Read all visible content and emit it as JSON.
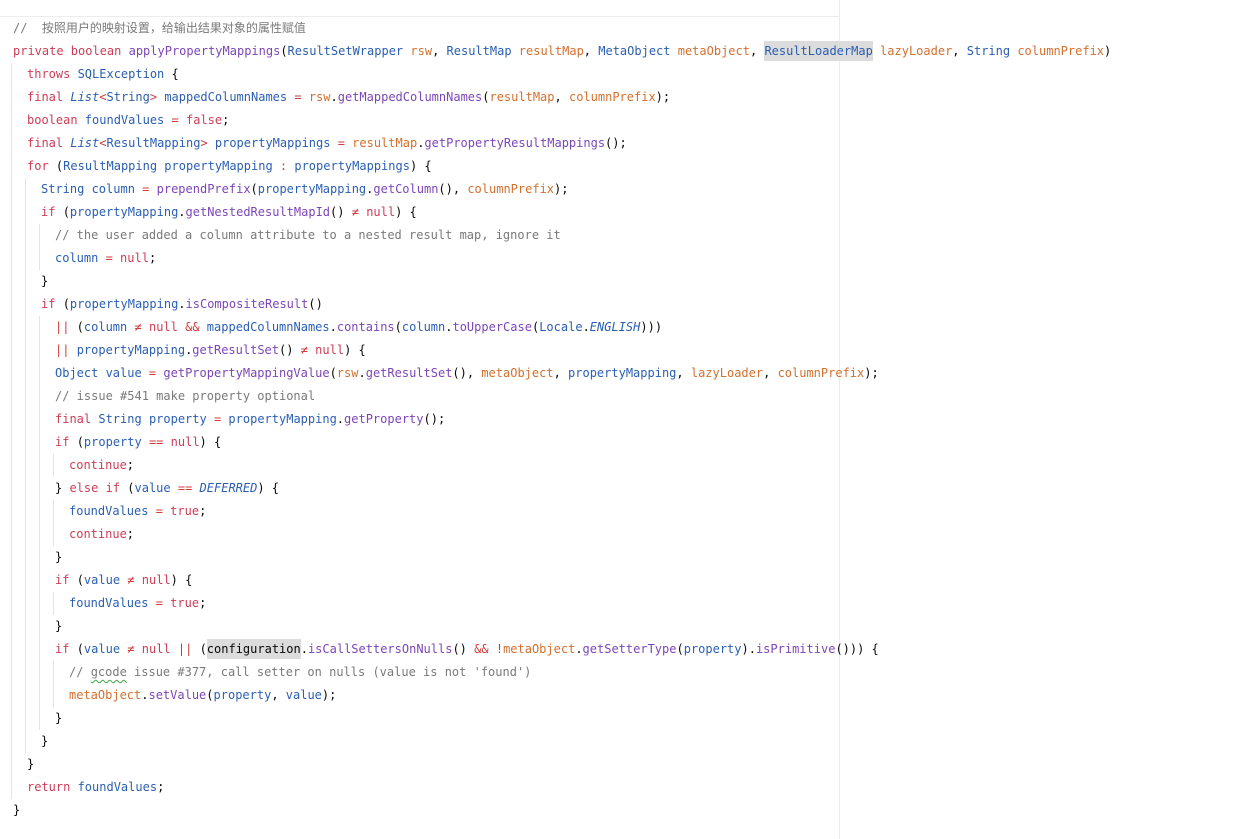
{
  "editor": {
    "lines": [
      {
        "indent": 0,
        "tokens": [
          {
            "t": "//  按照用户的映射设置，给输出结果对象的属性赋值",
            "c": "co"
          }
        ]
      },
      {
        "indent": 0,
        "tokens": [
          {
            "t": "private ",
            "c": "kw"
          },
          {
            "t": "boolean ",
            "c": "kw"
          },
          {
            "t": "applyPropertyMappings",
            "c": "me"
          },
          {
            "t": "(",
            "c": "pu"
          },
          {
            "t": "ResultSetWrapper ",
            "c": "ty"
          },
          {
            "t": "rsw",
            "c": "pa"
          },
          {
            "t": ", ",
            "c": "pu"
          },
          {
            "t": "ResultMap ",
            "c": "ty"
          },
          {
            "t": "resultMap",
            "c": "pa"
          },
          {
            "t": ", ",
            "c": "pu"
          },
          {
            "t": "MetaObject ",
            "c": "ty"
          },
          {
            "t": "metaObject",
            "c": "pa"
          },
          {
            "t": ", ",
            "c": "pu"
          },
          {
            "t": "ResultLoaderMap",
            "c": "ty hl"
          },
          {
            "t": " ",
            "c": "pu"
          },
          {
            "t": "lazyLoader",
            "c": "pa"
          },
          {
            "t": ", ",
            "c": "pu"
          },
          {
            "t": "String ",
            "c": "ty"
          },
          {
            "t": "columnPrefix",
            "c": "pa"
          },
          {
            "t": ")",
            "c": "pu"
          }
        ]
      },
      {
        "indent": 1,
        "tokens": [
          {
            "t": "throws ",
            "c": "kw"
          },
          {
            "t": "SQLException",
            "c": "ty"
          },
          {
            "t": " {",
            "c": "pu"
          }
        ]
      },
      {
        "indent": 1,
        "tokens": [
          {
            "t": "final ",
            "c": "kw"
          },
          {
            "t": "List",
            "c": "ty-it"
          },
          {
            "t": "<",
            "c": "op"
          },
          {
            "t": "String",
            "c": "ty"
          },
          {
            "t": "> ",
            "c": "op"
          },
          {
            "t": "mappedColumnNames",
            "c": "va"
          },
          {
            "t": " = ",
            "c": "op"
          },
          {
            "t": "rsw",
            "c": "pa"
          },
          {
            "t": ".",
            "c": "pu"
          },
          {
            "t": "getMappedColumnNames",
            "c": "me"
          },
          {
            "t": "(",
            "c": "pu"
          },
          {
            "t": "resultMap",
            "c": "pa"
          },
          {
            "t": ", ",
            "c": "pu"
          },
          {
            "t": "columnPrefix",
            "c": "pa"
          },
          {
            "t": ");",
            "c": "pu"
          }
        ]
      },
      {
        "indent": 1,
        "tokens": [
          {
            "t": "boolean ",
            "c": "kw"
          },
          {
            "t": "foundValues",
            "c": "va"
          },
          {
            "t": " = ",
            "c": "op"
          },
          {
            "t": "false",
            "c": "kw"
          },
          {
            "t": ";",
            "c": "pu"
          }
        ]
      },
      {
        "indent": 1,
        "tokens": [
          {
            "t": "final ",
            "c": "kw"
          },
          {
            "t": "List",
            "c": "ty-it"
          },
          {
            "t": "<",
            "c": "op"
          },
          {
            "t": "ResultMapping",
            "c": "ty"
          },
          {
            "t": "> ",
            "c": "op"
          },
          {
            "t": "propertyMappings",
            "c": "va"
          },
          {
            "t": " = ",
            "c": "op"
          },
          {
            "t": "resultMap",
            "c": "pa"
          },
          {
            "t": ".",
            "c": "pu"
          },
          {
            "t": "getPropertyResultMappings",
            "c": "me"
          },
          {
            "t": "();",
            "c": "pu"
          }
        ]
      },
      {
        "indent": 1,
        "tokens": [
          {
            "t": "for ",
            "c": "kw"
          },
          {
            "t": "(",
            "c": "pu"
          },
          {
            "t": "ResultMapping ",
            "c": "ty"
          },
          {
            "t": "propertyMapping",
            "c": "va"
          },
          {
            "t": " : ",
            "c": "op"
          },
          {
            "t": "propertyMappings",
            "c": "va"
          },
          {
            "t": ") {",
            "c": "pu"
          }
        ]
      },
      {
        "indent": 2,
        "tokens": [
          {
            "t": "String ",
            "c": "ty"
          },
          {
            "t": "column",
            "c": "va"
          },
          {
            "t": " = ",
            "c": "op"
          },
          {
            "t": "prependPrefix",
            "c": "me"
          },
          {
            "t": "(",
            "c": "pu"
          },
          {
            "t": "propertyMapping",
            "c": "va"
          },
          {
            "t": ".",
            "c": "pu"
          },
          {
            "t": "getColumn",
            "c": "me"
          },
          {
            "t": "(), ",
            "c": "pu"
          },
          {
            "t": "columnPrefix",
            "c": "pa"
          },
          {
            "t": ");",
            "c": "pu"
          }
        ]
      },
      {
        "indent": 2,
        "tokens": [
          {
            "t": "if ",
            "c": "kw"
          },
          {
            "t": "(",
            "c": "pu"
          },
          {
            "t": "propertyMapping",
            "c": "va"
          },
          {
            "t": ".",
            "c": "pu"
          },
          {
            "t": "getNestedResultMapId",
            "c": "me"
          },
          {
            "t": "() ",
            "c": "pu"
          },
          {
            "t": "≠",
            "c": "op"
          },
          {
            "t": " ",
            "c": "pu"
          },
          {
            "t": "null",
            "c": "kw"
          },
          {
            "t": ") {",
            "c": "pu"
          }
        ]
      },
      {
        "indent": 3,
        "tokens": [
          {
            "t": "// the user added a column attribute to a nested result map, ignore it",
            "c": "co"
          }
        ]
      },
      {
        "indent": 3,
        "tokens": [
          {
            "t": "column",
            "c": "va"
          },
          {
            "t": " = ",
            "c": "op"
          },
          {
            "t": "null",
            "c": "kw"
          },
          {
            "t": ";",
            "c": "pu"
          }
        ]
      },
      {
        "indent": 2,
        "tokens": [
          {
            "t": "}",
            "c": "pu"
          }
        ]
      },
      {
        "indent": 2,
        "tokens": [
          {
            "t": "if ",
            "c": "kw"
          },
          {
            "t": "(",
            "c": "pu"
          },
          {
            "t": "propertyMapping",
            "c": "va"
          },
          {
            "t": ".",
            "c": "pu"
          },
          {
            "t": "isCompositeResult",
            "c": "me"
          },
          {
            "t": "()",
            "c": "pu"
          }
        ]
      },
      {
        "indent": 3,
        "tokens": [
          {
            "t": "||",
            "c": "op"
          },
          {
            "t": " (",
            "c": "pu"
          },
          {
            "t": "column",
            "c": "va"
          },
          {
            "t": " ",
            "c": "pu"
          },
          {
            "t": "≠",
            "c": "op"
          },
          {
            "t": " ",
            "c": "pu"
          },
          {
            "t": "null",
            "c": "kw"
          },
          {
            "t": " ",
            "c": "pu"
          },
          {
            "t": "&&",
            "c": "op"
          },
          {
            "t": " ",
            "c": "pu"
          },
          {
            "t": "mappedColumnNames",
            "c": "va"
          },
          {
            "t": ".",
            "c": "pu"
          },
          {
            "t": "contains",
            "c": "me"
          },
          {
            "t": "(",
            "c": "pu"
          },
          {
            "t": "column",
            "c": "va"
          },
          {
            "t": ".",
            "c": "pu"
          },
          {
            "t": "toUpperCase",
            "c": "me"
          },
          {
            "t": "(",
            "c": "pu"
          },
          {
            "t": "Locale",
            "c": "ty"
          },
          {
            "t": ".",
            "c": "pu"
          },
          {
            "t": "ENGLISH",
            "c": "cn"
          },
          {
            "t": ")))",
            "c": "pu"
          }
        ]
      },
      {
        "indent": 3,
        "tokens": [
          {
            "t": "||",
            "c": "op"
          },
          {
            "t": " ",
            "c": "pu"
          },
          {
            "t": "propertyMapping",
            "c": "va"
          },
          {
            "t": ".",
            "c": "pu"
          },
          {
            "t": "getResultSet",
            "c": "me"
          },
          {
            "t": "() ",
            "c": "pu"
          },
          {
            "t": "≠",
            "c": "op"
          },
          {
            "t": " ",
            "c": "pu"
          },
          {
            "t": "null",
            "c": "kw"
          },
          {
            "t": ") {",
            "c": "pu"
          }
        ]
      },
      {
        "indent": 3,
        "tokens": [
          {
            "t": "Object ",
            "c": "ty"
          },
          {
            "t": "value",
            "c": "va"
          },
          {
            "t": " = ",
            "c": "op"
          },
          {
            "t": "getPropertyMappingValue",
            "c": "me"
          },
          {
            "t": "(",
            "c": "pu"
          },
          {
            "t": "rsw",
            "c": "pa"
          },
          {
            "t": ".",
            "c": "pu"
          },
          {
            "t": "getResultSet",
            "c": "me"
          },
          {
            "t": "(), ",
            "c": "pu"
          },
          {
            "t": "metaObject",
            "c": "pa"
          },
          {
            "t": ", ",
            "c": "pu"
          },
          {
            "t": "propertyMapping",
            "c": "va"
          },
          {
            "t": ", ",
            "c": "pu"
          },
          {
            "t": "lazyLoader",
            "c": "pa"
          },
          {
            "t": ", ",
            "c": "pu"
          },
          {
            "t": "columnPrefix",
            "c": "pa"
          },
          {
            "t": ");",
            "c": "pu"
          }
        ]
      },
      {
        "indent": 3,
        "tokens": [
          {
            "t": "// issue #541 make property optional",
            "c": "co"
          }
        ]
      },
      {
        "indent": 3,
        "tokens": [
          {
            "t": "final ",
            "c": "kw"
          },
          {
            "t": "String ",
            "c": "ty"
          },
          {
            "t": "property",
            "c": "va"
          },
          {
            "t": " = ",
            "c": "op"
          },
          {
            "t": "propertyMapping",
            "c": "va"
          },
          {
            "t": ".",
            "c": "pu"
          },
          {
            "t": "getProperty",
            "c": "me"
          },
          {
            "t": "();",
            "c": "pu"
          }
        ]
      },
      {
        "indent": 3,
        "tokens": [
          {
            "t": "if ",
            "c": "kw"
          },
          {
            "t": "(",
            "c": "pu"
          },
          {
            "t": "property",
            "c": "va"
          },
          {
            "t": " ",
            "c": "pu"
          },
          {
            "t": "==",
            "c": "op"
          },
          {
            "t": " ",
            "c": "pu"
          },
          {
            "t": "null",
            "c": "kw"
          },
          {
            "t": ") {",
            "c": "pu"
          }
        ]
      },
      {
        "indent": 4,
        "tokens": [
          {
            "t": "continue",
            "c": "kw"
          },
          {
            "t": ";",
            "c": "pu"
          }
        ]
      },
      {
        "indent": 3,
        "tokens": [
          {
            "t": "} ",
            "c": "pu"
          },
          {
            "t": "else ",
            "c": "kw"
          },
          {
            "t": "if ",
            "c": "kw"
          },
          {
            "t": "(",
            "c": "pu"
          },
          {
            "t": "value",
            "c": "va"
          },
          {
            "t": " ",
            "c": "pu"
          },
          {
            "t": "==",
            "c": "op"
          },
          {
            "t": " ",
            "c": "pu"
          },
          {
            "t": "DEFERRED",
            "c": "cn"
          },
          {
            "t": ") {",
            "c": "pu"
          }
        ]
      },
      {
        "indent": 4,
        "tokens": [
          {
            "t": "foundValues",
            "c": "va"
          },
          {
            "t": " = ",
            "c": "op"
          },
          {
            "t": "true",
            "c": "kw"
          },
          {
            "t": ";",
            "c": "pu"
          }
        ]
      },
      {
        "indent": 4,
        "tokens": [
          {
            "t": "continue",
            "c": "kw"
          },
          {
            "t": ";",
            "c": "pu"
          }
        ]
      },
      {
        "indent": 3,
        "tokens": [
          {
            "t": "}",
            "c": "pu"
          }
        ]
      },
      {
        "indent": 3,
        "tokens": [
          {
            "t": "if ",
            "c": "kw"
          },
          {
            "t": "(",
            "c": "pu"
          },
          {
            "t": "value",
            "c": "va"
          },
          {
            "t": " ",
            "c": "pu"
          },
          {
            "t": "≠",
            "c": "op"
          },
          {
            "t": " ",
            "c": "pu"
          },
          {
            "t": "null",
            "c": "kw"
          },
          {
            "t": ") {",
            "c": "pu"
          }
        ]
      },
      {
        "indent": 4,
        "tokens": [
          {
            "t": "foundValues",
            "c": "va"
          },
          {
            "t": " = ",
            "c": "op"
          },
          {
            "t": "true",
            "c": "kw"
          },
          {
            "t": ";",
            "c": "pu"
          }
        ]
      },
      {
        "indent": 3,
        "tokens": [
          {
            "t": "}",
            "c": "pu"
          }
        ]
      },
      {
        "indent": 3,
        "tokens": [
          {
            "t": "if ",
            "c": "kw"
          },
          {
            "t": "(",
            "c": "pu"
          },
          {
            "t": "value",
            "c": "va"
          },
          {
            "t": " ",
            "c": "pu"
          },
          {
            "t": "≠",
            "c": "op"
          },
          {
            "t": " ",
            "c": "pu"
          },
          {
            "t": "null",
            "c": "kw"
          },
          {
            "t": " ",
            "c": "pu"
          },
          {
            "t": "||",
            "c": "op"
          },
          {
            "t": " (",
            "c": "pu"
          },
          {
            "t": "configuration",
            "c": "pu hl"
          },
          {
            "t": ".",
            "c": "pu"
          },
          {
            "t": "isCallSettersOnNulls",
            "c": "me"
          },
          {
            "t": "() ",
            "c": "pu"
          },
          {
            "t": "&&",
            "c": "op"
          },
          {
            "t": " ",
            "c": "pu"
          },
          {
            "t": "!",
            "c": "op"
          },
          {
            "t": "metaObject",
            "c": "pa"
          },
          {
            "t": ".",
            "c": "pu"
          },
          {
            "t": "getSetterType",
            "c": "me"
          },
          {
            "t": "(",
            "c": "pu"
          },
          {
            "t": "property",
            "c": "va"
          },
          {
            "t": ").",
            "c": "pu"
          },
          {
            "t": "isPrimitive",
            "c": "me"
          },
          {
            "t": "())) {",
            "c": "pu"
          }
        ]
      },
      {
        "indent": 4,
        "tokens": [
          {
            "t": "// ",
            "c": "co"
          },
          {
            "t": "gcode",
            "c": "co squig"
          },
          {
            "t": " issue #377, call setter on nulls (value is not 'found')",
            "c": "co"
          }
        ]
      },
      {
        "indent": 4,
        "tokens": [
          {
            "t": "metaObject",
            "c": "pa"
          },
          {
            "t": ".",
            "c": "pu"
          },
          {
            "t": "setValue",
            "c": "me"
          },
          {
            "t": "(",
            "c": "pu"
          },
          {
            "t": "property",
            "c": "va"
          },
          {
            "t": ", ",
            "c": "pu"
          },
          {
            "t": "value",
            "c": "va"
          },
          {
            "t": ");",
            "c": "pu"
          }
        ]
      },
      {
        "indent": 3,
        "tokens": [
          {
            "t": "}",
            "c": "pu"
          }
        ]
      },
      {
        "indent": 2,
        "tokens": [
          {
            "t": "}",
            "c": "pu"
          }
        ]
      },
      {
        "indent": 1,
        "tokens": [
          {
            "t": "}",
            "c": "pu"
          }
        ]
      },
      {
        "indent": 1,
        "tokens": [
          {
            "t": "return ",
            "c": "kw"
          },
          {
            "t": "foundValues",
            "c": "va"
          },
          {
            "t": ";",
            "c": "pu"
          }
        ]
      },
      {
        "indent": 0,
        "tokens": [
          {
            "t": "}",
            "c": "pu"
          }
        ]
      }
    ]
  }
}
